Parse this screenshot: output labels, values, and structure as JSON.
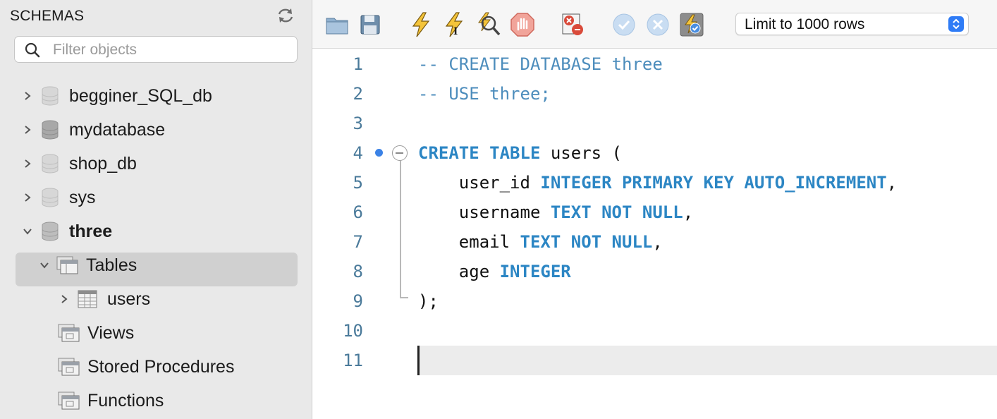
{
  "sidebar": {
    "title": "SCHEMAS",
    "filter_placeholder": "Filter objects",
    "schemas": [
      {
        "name": "begginer_SQL_db",
        "expanded": false
      },
      {
        "name": "mydatabase",
        "expanded": false
      },
      {
        "name": "shop_db",
        "expanded": false
      },
      {
        "name": "sys",
        "expanded": false
      },
      {
        "name": "three",
        "expanded": true,
        "active": true
      }
    ],
    "three_children": {
      "tables": "Tables",
      "table_users": "users",
      "views": "Views",
      "stored_procedures": "Stored Procedures",
      "functions": "Functions"
    }
  },
  "toolbar": {
    "buttons": [
      "open-file-icon",
      "save-icon",
      "execute-icon",
      "execute-current-icon",
      "explain-icon",
      "stop-icon",
      "toggle-error-stop-icon",
      "commit-icon",
      "rollback-icon",
      "autocommit-icon"
    ],
    "limit_label": "Limit to 1000 rows"
  },
  "editor": {
    "line_numbers": [
      "1",
      "2",
      "3",
      "4",
      "5",
      "6",
      "7",
      "8",
      "9",
      "10",
      "11"
    ],
    "lines": {
      "l1": "-- CREATE DATABASE three",
      "l2": "-- USE three;",
      "l4_kw": "CREATE TABLE",
      "l4_rest": " users (",
      "l5_ident": "    user_id ",
      "l5_kw": "INTEGER PRIMARY KEY AUTO_INCREMENT",
      "l5_tail": ",",
      "l6_ident": "    username ",
      "l6_kw": "TEXT NOT NULL",
      "l6_tail": ",",
      "l7_ident": "    email ",
      "l7_kw": "TEXT NOT NULL",
      "l7_tail": ",",
      "l8_ident": "    age ",
      "l8_kw": "INTEGER",
      "l9": ");"
    },
    "colors": {
      "keyword": "#2c86c4",
      "comment": "#4d8dbc",
      "line_number": "#4a7a9a"
    }
  }
}
